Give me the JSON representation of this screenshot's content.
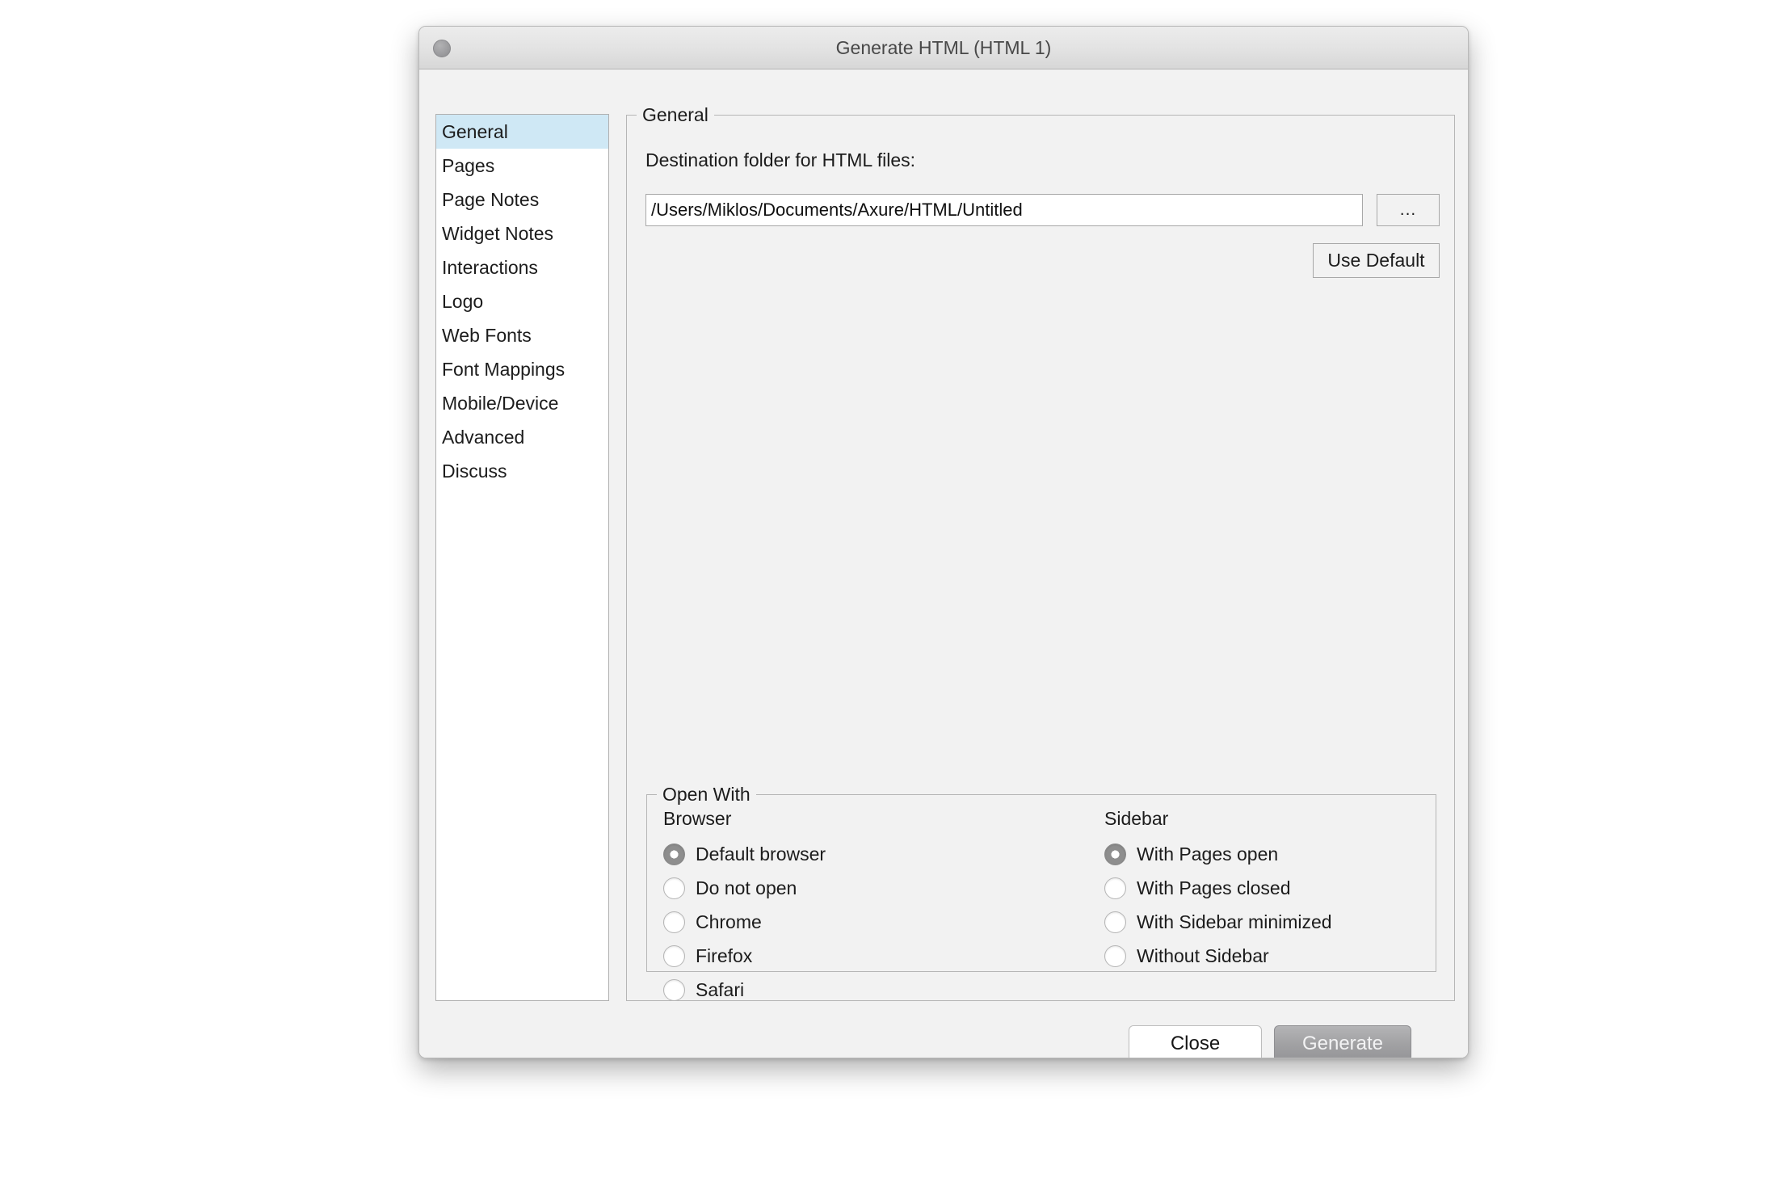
{
  "window": {
    "title": "Generate HTML (HTML 1)",
    "close_button": "close-dot"
  },
  "sidebar": {
    "items": [
      {
        "label": "General",
        "selected": true
      },
      {
        "label": "Pages",
        "selected": false
      },
      {
        "label": "Page Notes",
        "selected": false
      },
      {
        "label": "Widget Notes",
        "selected": false
      },
      {
        "label": "Interactions",
        "selected": false
      },
      {
        "label": "Logo",
        "selected": false
      },
      {
        "label": "Web Fonts",
        "selected": false
      },
      {
        "label": "Font Mappings",
        "selected": false
      },
      {
        "label": "Mobile/Device",
        "selected": false
      },
      {
        "label": "Advanced",
        "selected": false
      },
      {
        "label": "Discuss",
        "selected": false
      }
    ]
  },
  "general_group": {
    "legend": "General",
    "destination_label": "Destination folder for HTML files:",
    "destination_value": "/Users/Miklos/Documents/Axure/HTML/Untitled",
    "destination_placeholder": "",
    "browse_label": "...",
    "use_default_label": "Use Default"
  },
  "open_with_group": {
    "legend": "Open With",
    "browser": {
      "title": "Browser",
      "options": [
        {
          "label": "Default browser",
          "checked": true
        },
        {
          "label": "Do not open",
          "checked": false
        },
        {
          "label": "Chrome",
          "checked": false
        },
        {
          "label": "Firefox",
          "checked": false
        },
        {
          "label": "Safari",
          "checked": false
        }
      ]
    },
    "sidebar": {
      "title": "Sidebar",
      "options": [
        {
          "label": "With Pages open",
          "checked": true
        },
        {
          "label": "With Pages closed",
          "checked": false
        },
        {
          "label": "With Sidebar minimized",
          "checked": false
        },
        {
          "label": "Without Sidebar",
          "checked": false
        }
      ]
    }
  },
  "footer": {
    "close_label": "Close",
    "generate_label": "Generate"
  },
  "colors": {
    "selection_blue": "#cfe8f5",
    "window_bg": "#f2f2f2",
    "radio_fill": "#8e8e8e",
    "generate_bg": "#a2a2a4"
  }
}
